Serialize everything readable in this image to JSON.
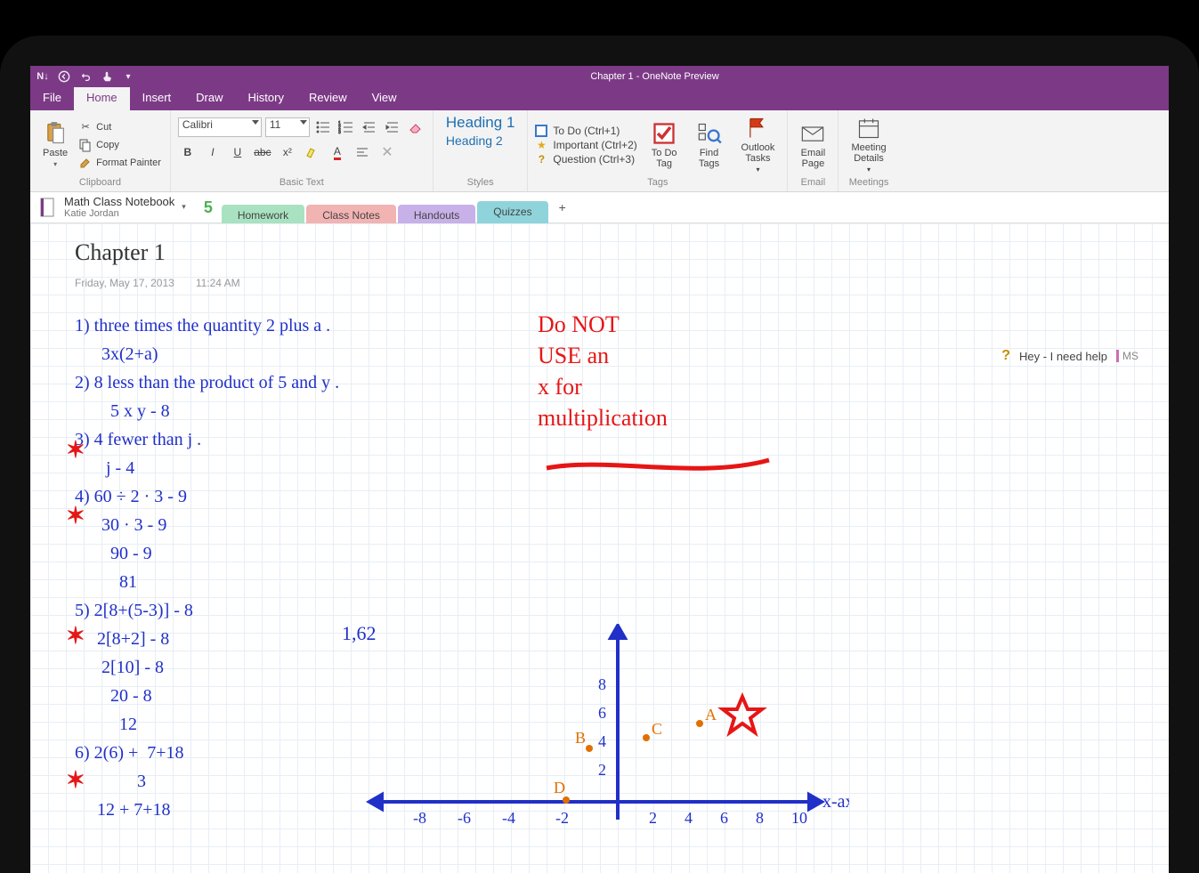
{
  "window": {
    "document_title": "Chapter 1",
    "app_title": " - OneNote Preview",
    "qat_app_glyph": "N↓"
  },
  "menubar": {
    "items": [
      "File",
      "Home",
      "Insert",
      "Draw",
      "History",
      "Review",
      "View"
    ],
    "active": "Home"
  },
  "ribbon": {
    "clipboard": {
      "paste": "Paste",
      "cut": "Cut",
      "copy": "Copy",
      "format_painter": "Format Painter",
      "group_name": "Clipboard"
    },
    "font": {
      "name": "Calibri",
      "size": "11",
      "group_name": "Basic Text"
    },
    "styles": {
      "h1": "Heading 1",
      "h2": "Heading 2",
      "group_name": "Styles"
    },
    "tags": {
      "items": [
        {
          "icon": "todo-box",
          "label": "To Do (Ctrl+1)"
        },
        {
          "icon": "star",
          "label": "Important (Ctrl+2)"
        },
        {
          "icon": "question",
          "label": "Question (Ctrl+3)"
        }
      ],
      "todo_tag": "To Do\nTag",
      "find_tags": "Find\nTags",
      "outlook": "Outlook\nTasks",
      "group_name": "Tags"
    },
    "email": {
      "label": "Email\nPage",
      "group_name": "Email"
    },
    "meetings": {
      "label": "Meeting\nDetails",
      "group_name": "Meetings"
    }
  },
  "notebook": {
    "name": "Math Class Notebook",
    "user": "Katie Jordan",
    "new_count": "5",
    "section_tabs": [
      {
        "label": "Homework",
        "color": "#a9e2c1"
      },
      {
        "label": "Class Notes",
        "color": "#f2b3b3"
      },
      {
        "label": "Handouts",
        "color": "#c8b0e8"
      },
      {
        "label": "Quizzes",
        "color": "#8fd4da",
        "active": true
      }
    ],
    "add_tab": "+"
  },
  "page": {
    "title": "Chapter 1",
    "date": "Friday, May 17, 2013",
    "time": "11:24 AM",
    "help_note": "Hey - I need help",
    "author_initials": "MS"
  },
  "handwriting": {
    "left_lines": [
      "1) three times the quantity 2 plus a .",
      "      3x(2+a)",
      "2) 8 less than the product of 5 and y .",
      "        5 x y - 8",
      "3) 4 fewer than j .",
      "       j - 4",
      "4) 60 ÷ 2 · 3 - 9",
      "      30 · 3 - 9",
      "        90 - 9",
      "          81",
      "5) 2[8+(5-3)] - 8",
      "     2[8+2] - 8",
      "      2[10] - 8",
      "        20 - 8",
      "          12",
      "6) 2(6) +  7+18",
      "              3",
      "     12 + 7+18"
    ],
    "side_number": "1,62",
    "red_note": [
      "Do NOT",
      "USE an",
      "x  for",
      "multiplication"
    ],
    "graph": {
      "x_label": "x-axis",
      "x_ticks": [
        "-8",
        "-6",
        "-4",
        "-2",
        "2",
        "4",
        "6",
        "8",
        "10"
      ],
      "y_ticks": [
        "2",
        "4",
        "6",
        "8"
      ],
      "points": {
        "A": "A",
        "B": "B",
        "C": "C",
        "D": "D"
      }
    }
  }
}
